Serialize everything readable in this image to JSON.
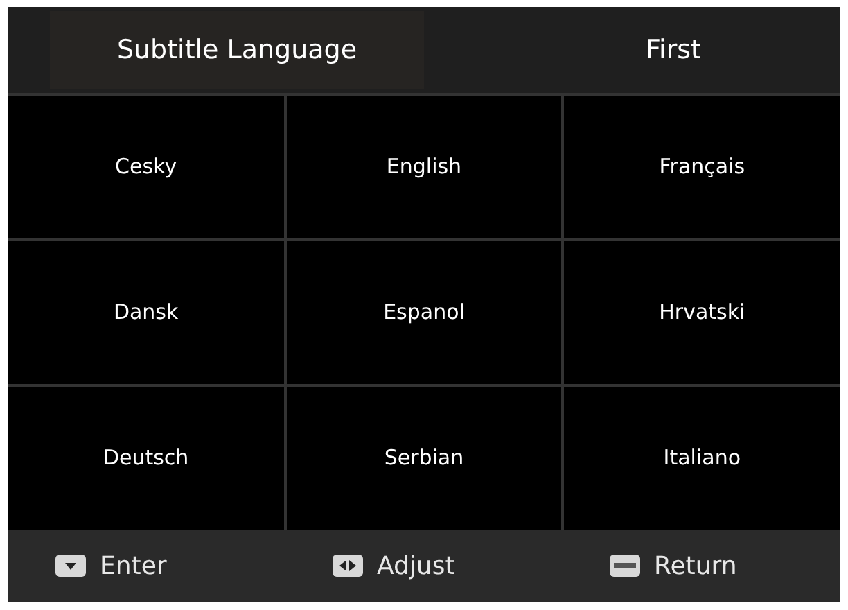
{
  "header": {
    "title": "Subtitle Language",
    "value": "First"
  },
  "languages": [
    "Cesky",
    "English",
    "Français",
    "Dansk",
    "Espanol",
    "Hrvatski",
    "Deutsch",
    "Serbian",
    "Italiano"
  ],
  "footer": [
    {
      "kind": "down",
      "label": "Enter"
    },
    {
      "kind": "leftright",
      "label": "Adjust"
    },
    {
      "kind": "menu",
      "label": "Return"
    }
  ]
}
